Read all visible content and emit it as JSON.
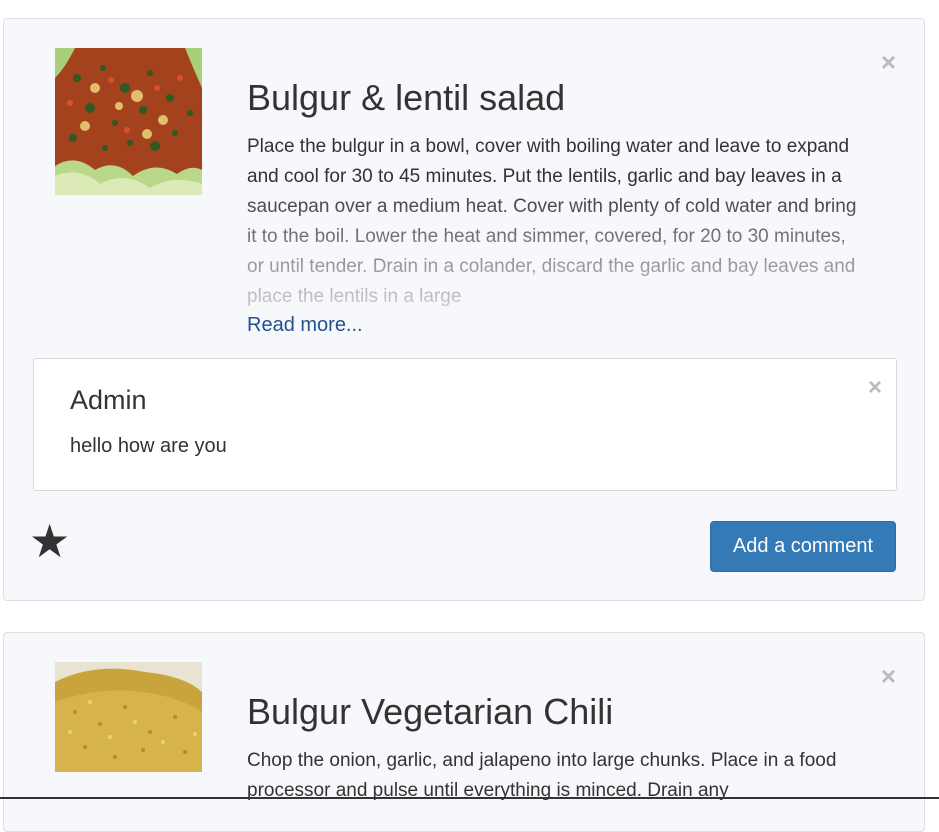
{
  "recipes": [
    {
      "title": "Bulgur & lentil salad",
      "description": "Place the bulgur in a bowl, cover with boiling water and leave to expand and cool for 30 to 45 minutes. Put the lentils, garlic and bay leaves in a saucepan over a medium heat. Cover with plenty of cold water and bring it to the boil. Lower the heat and simmer, covered, for 20 to 30 minutes, or until tender. Drain in a colander, discard the garlic and bay leaves and place the lentils in a large",
      "read_more": "Read more...",
      "close_symbol": "×",
      "image_icon": "salad-photo",
      "comment": {
        "author": "Admin",
        "text": "hello how are you",
        "close_symbol": "×"
      },
      "star_symbol": "★",
      "add_comment_label": "Add a comment"
    },
    {
      "title": "Bulgur Vegetarian Chili",
      "description": "Chop the onion, garlic, and jalapeno into large chunks. Place in a food processor and pulse until everything is minced. Drain any",
      "close_symbol": "×",
      "image_icon": "bulgur-grain-photo"
    }
  ],
  "colors": {
    "card_background": "#f7f8fb",
    "primary_button": "#337ab7",
    "link": "#23518f"
  }
}
